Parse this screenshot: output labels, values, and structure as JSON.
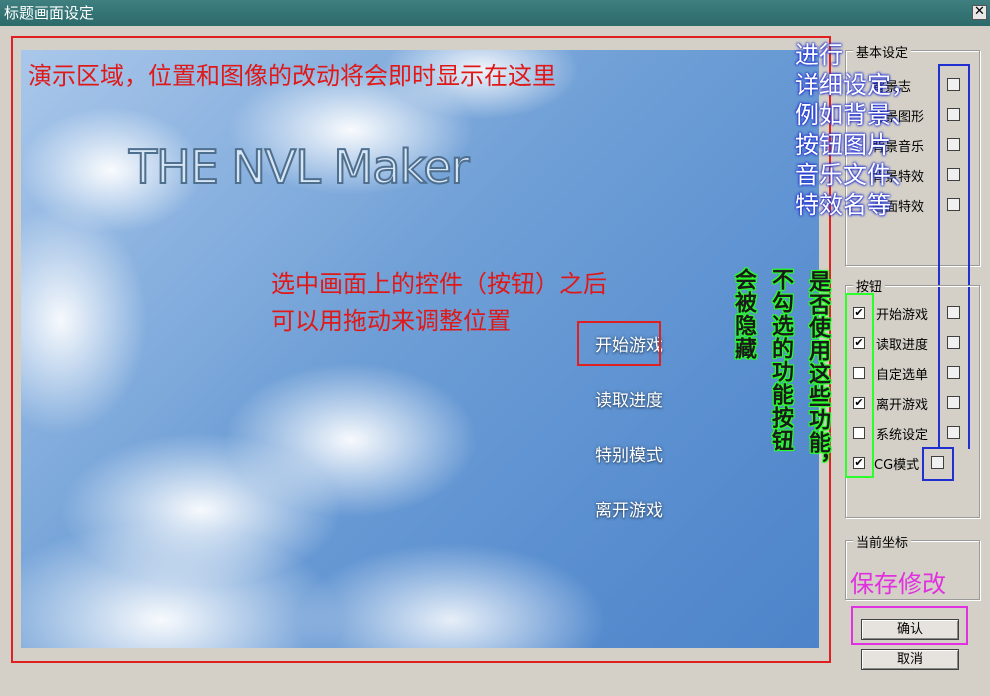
{
  "window": {
    "title": "标题画面设定",
    "close_glyph": "✕"
  },
  "preview": {
    "logo": "THE NVL Maker",
    "menu_buttons": [
      "开始游戏",
      "读取进度",
      "特别模式",
      "离开游戏"
    ]
  },
  "notes": {
    "demo_area": "演示区域，位置和图像的改动将会即时显示在这里",
    "drag_hint_1": "选中画面上的控件（按钮）之后",
    "drag_hint_2": "可以用拖动来调整位置",
    "detail_1": "进行",
    "detail_2": "详细设定，",
    "detail_3": "例如背景、",
    "detail_4": "按钮图片",
    "detail_5": "音乐文件、",
    "detail_6": "特效名等",
    "col_1": "是否使用这些功能，",
    "col_2": "不勾选的功能按钮",
    "col_3": "会被隐藏",
    "save": "保存修改"
  },
  "basic_settings": {
    "label": "基本设定",
    "items": [
      "背景志",
      "背景图形",
      "背景音乐",
      "背景特效",
      "画面特效"
    ]
  },
  "buttons_group": {
    "label": "按钮",
    "items": [
      {
        "label": "开始游戏",
        "checked": true
      },
      {
        "label": "读取进度",
        "checked": true
      },
      {
        "label": "自定选单",
        "checked": false
      },
      {
        "label": "离开游戏",
        "checked": true
      },
      {
        "label": "系统设定",
        "checked": false
      },
      {
        "label": "CG模式",
        "checked": true
      }
    ],
    "check_glyph": "✔"
  },
  "coords": {
    "label": "当前坐标"
  },
  "actions": {
    "ok": "确认",
    "cancel": "取消"
  },
  "colors": {
    "annotation_red": "#e02020",
    "annotation_blue": "#2030d0",
    "annotation_green": "#2cff2c",
    "annotation_magenta": "#e030e0"
  }
}
